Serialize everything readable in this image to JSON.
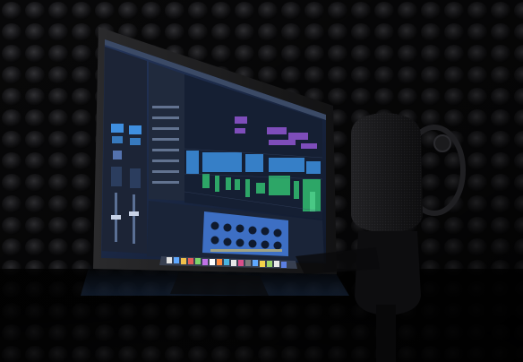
{
  "scene": {
    "description_tags": [
      "recording-booth",
      "acoustic-foam",
      "monitor",
      "daw-software",
      "condenser-microphone"
    ],
    "colors": {
      "foam": "#151517",
      "screen_bg": "#1a2a44",
      "track_green": "#2fae6a",
      "track_purple": "#8a52c9",
      "track_blue": "#3a8ad8",
      "plugin_blue": "#3d6fc4"
    }
  }
}
